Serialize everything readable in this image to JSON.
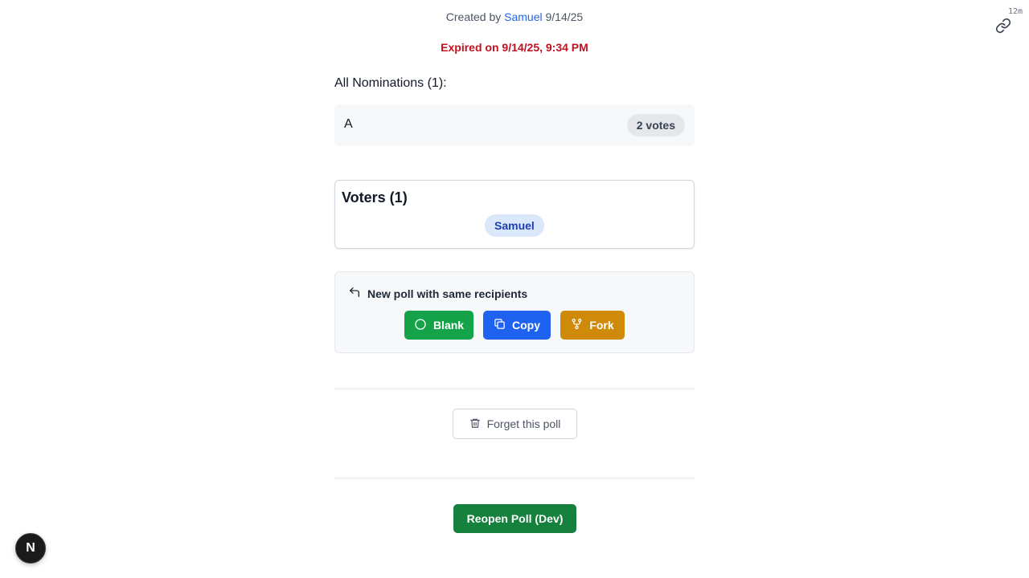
{
  "header": {
    "created_prefix": "Created by",
    "author": "Samuel",
    "created_date": "9/14/25",
    "expired_text": "Expired on 9/14/25, 9:34 PM",
    "age": "12m"
  },
  "nominations": {
    "heading": "All Nominations (1):",
    "items": [
      {
        "name": "A",
        "votes": "2 votes"
      }
    ]
  },
  "voters": {
    "title": "Voters (1)",
    "names": [
      "Samuel"
    ]
  },
  "new_poll": {
    "heading": "New poll with same recipients",
    "buttons": {
      "blank": "Blank",
      "copy": "Copy",
      "fork": "Fork"
    }
  },
  "actions": {
    "forget": "Forget this poll",
    "reopen": "Reopen Poll (Dev)"
  },
  "badge": {
    "letter": "N"
  },
  "colors": {
    "expired": "#c1121f",
    "blank": "#15a34a",
    "copy": "#1f62f0",
    "fork": "#d08a09",
    "reopen": "#16803d",
    "link": "#2563eb"
  }
}
